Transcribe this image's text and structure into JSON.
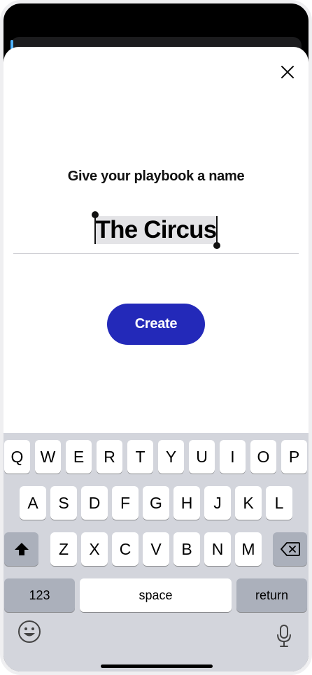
{
  "screen": {
    "heading": "Give your playbook a name",
    "name_value": "The Circus",
    "create_label": "Create"
  },
  "icons": {
    "close": "close-icon",
    "shift": "shift-icon",
    "delete": "delete-icon",
    "emoji": "emoji-icon",
    "mic": "microphone-icon"
  },
  "keyboard": {
    "row1": [
      "Q",
      "W",
      "E",
      "R",
      "T",
      "Y",
      "U",
      "I",
      "O",
      "P"
    ],
    "row2": [
      "A",
      "S",
      "D",
      "F",
      "G",
      "H",
      "J",
      "K",
      "L"
    ],
    "row3": [
      "Z",
      "X",
      "C",
      "V",
      "B",
      "N",
      "M"
    ],
    "numbers_label": "123",
    "space_label": "space",
    "return_label": "return"
  },
  "colors": {
    "accent": "#2329b9",
    "selection": "#e4e4e7",
    "keyboard_bg": "#d3d5dc"
  }
}
